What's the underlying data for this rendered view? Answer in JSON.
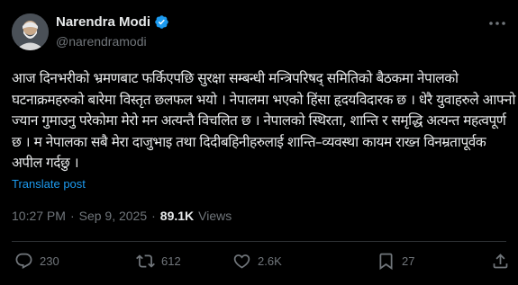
{
  "author": {
    "name": "Narendra Modi",
    "handle": "@narendramodi",
    "verified": true
  },
  "tweet": {
    "text": "आज दिनभरीको भ्रमणबाट फर्किएपछि सुरक्षा सम्बन्धी मन्त्रिपरिषद् समितिको बैठकमा नेपालको घटनाक्रमहरुको बारेमा विस्तृत छलफल भयो । नेपालमा भएको हिंसा हृदयविदारक छ । धेरै युवाहरुले आफ्नो ज्यान गुमाउनु परेकोमा मेरो मन अत्यन्तै विचलित छ । नेपालको स्थिरता, शान्ति र समृद्धि अत्यन्त महत्वपूर्ण छ । म नेपालका सबै मेरा दाजुभाइ तथा दिदीबहिनीहरुलाई शान्ति–व्यवस्था कायम राख्न विनम्रतापूर्वक अपील गर्दछु ।",
    "translate_label": "Translate post"
  },
  "meta": {
    "time": "10:27 PM",
    "separator": "·",
    "date": "Sep 9, 2025",
    "views_count": "89.1K",
    "views_label": "Views"
  },
  "actions": {
    "replies": "230",
    "reposts": "612",
    "likes": "2.6K",
    "bookmarks": "27"
  },
  "colors": {
    "background": "#000000",
    "text": "#e7e9ea",
    "muted": "#71767b",
    "accent": "#1d9bf0",
    "divider": "#2f3336"
  },
  "icons": {
    "reply": "reply-icon",
    "repost": "repost-icon",
    "like": "heart-icon",
    "bookmark": "bookmark-icon",
    "share": "share-icon",
    "more": "more-icon",
    "verified": "verified-badge-icon"
  }
}
